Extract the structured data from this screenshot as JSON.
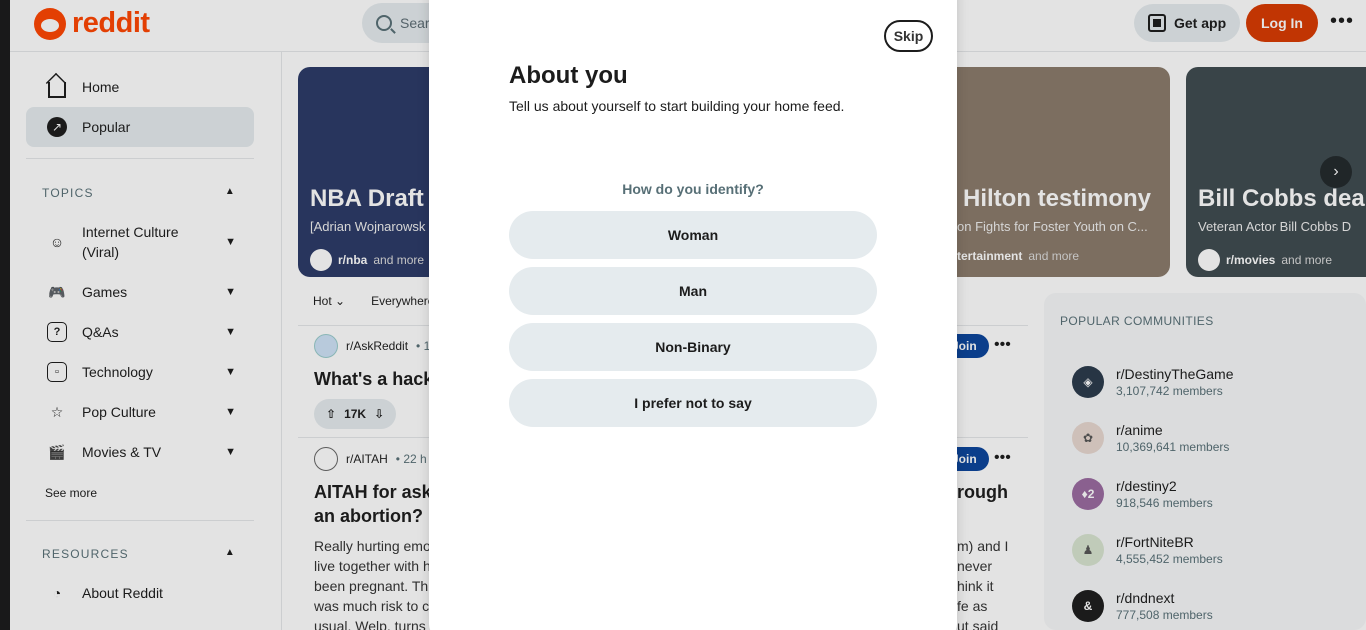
{
  "header": {
    "logo_text": "reddit",
    "search_placeholder": "Sear",
    "get_app_label": "Get app",
    "login_label": "Log In"
  },
  "sidebar": {
    "nav": [
      {
        "label": "Home",
        "icon": "home-icon"
      },
      {
        "label": "Popular",
        "icon": "popular-icon",
        "active": true
      }
    ],
    "topics_header": "TOPICS",
    "topics": [
      {
        "label": "Internet Culture (Viral)",
        "icon": "emoji-icon"
      },
      {
        "label": "Games",
        "icon": "gamepad-icon"
      },
      {
        "label": "Q&As",
        "icon": "question-icon"
      },
      {
        "label": "Technology",
        "icon": "chip-icon"
      },
      {
        "label": "Pop Culture",
        "icon": "star-icon"
      },
      {
        "label": "Movies & TV",
        "icon": "clapper-icon"
      }
    ],
    "see_more": "See more",
    "resources_header": "RESOURCES",
    "resources": [
      {
        "label": "About Reddit",
        "icon": "reddit-icon"
      }
    ]
  },
  "carousel": [
    {
      "title": "NBA Draft",
      "subtitle": "[Adrian Wojnarowsk",
      "community": "r/nba",
      "more": "and more",
      "bg": "#2b3a67"
    },
    {
      "title": "Hilton testimony",
      "subtitle": "on Fights for Foster Youth on C...",
      "community": "tertainment",
      "more": "and more",
      "bg": "#8a7a6a"
    },
    {
      "title": "Bill Cobbs dea",
      "subtitle": "Veteran Actor Bill Cobbs D",
      "community": "r/movies",
      "more": "and more",
      "bg": "#3e4a4f"
    }
  ],
  "feed": {
    "sort_label": "Hot",
    "location_label": "Everywhere",
    "posts": [
      {
        "subreddit": "r/AskReddit",
        "time": "• 1",
        "title": "What's a hack",
        "votes": "17K",
        "join": "Join"
      },
      {
        "subreddit": "r/AITAH",
        "time": "• 22 h",
        "title_line1": "AITAH for aski",
        "title_line2": "an abortion?",
        "title_right": "rough",
        "join": "Join",
        "body_left": [
          "Really hurting emo",
          "live together with h",
          "been pregnant. Thi",
          "was much risk to c",
          "usual. Welp, turns"
        ],
        "body_right": [
          "m) and I",
          "never",
          "hink it",
          "fe as",
          "ut said"
        ]
      }
    ]
  },
  "popular_communities": {
    "title": "POPULAR COMMUNITIES",
    "items": [
      {
        "name": "r/DestinyTheGame",
        "members": "3,107,742 members",
        "color": "#2a3a4a"
      },
      {
        "name": "r/anime",
        "members": "10,369,641 members",
        "color": "#e8d8d0"
      },
      {
        "name": "r/destiny2",
        "members": "918,546 members",
        "color": "#9a6aa0"
      },
      {
        "name": "r/FortNiteBR",
        "members": "4,555,452 members",
        "color": "#d8e4d0"
      },
      {
        "name": "r/dndnext",
        "members": "777,508 members",
        "color": "#1c1c1c"
      }
    ]
  },
  "modal": {
    "skip_label": "Skip",
    "title": "About you",
    "subtitle": "Tell us about yourself to start building your home feed.",
    "question": "How do you identify?",
    "options": [
      "Woman",
      "Man",
      "Non-Binary",
      "I prefer not to say"
    ]
  },
  "colors": {
    "brand": "#ff4500",
    "login": "#d93a00",
    "join": "#0a449b",
    "pill": "#e5ebee"
  }
}
